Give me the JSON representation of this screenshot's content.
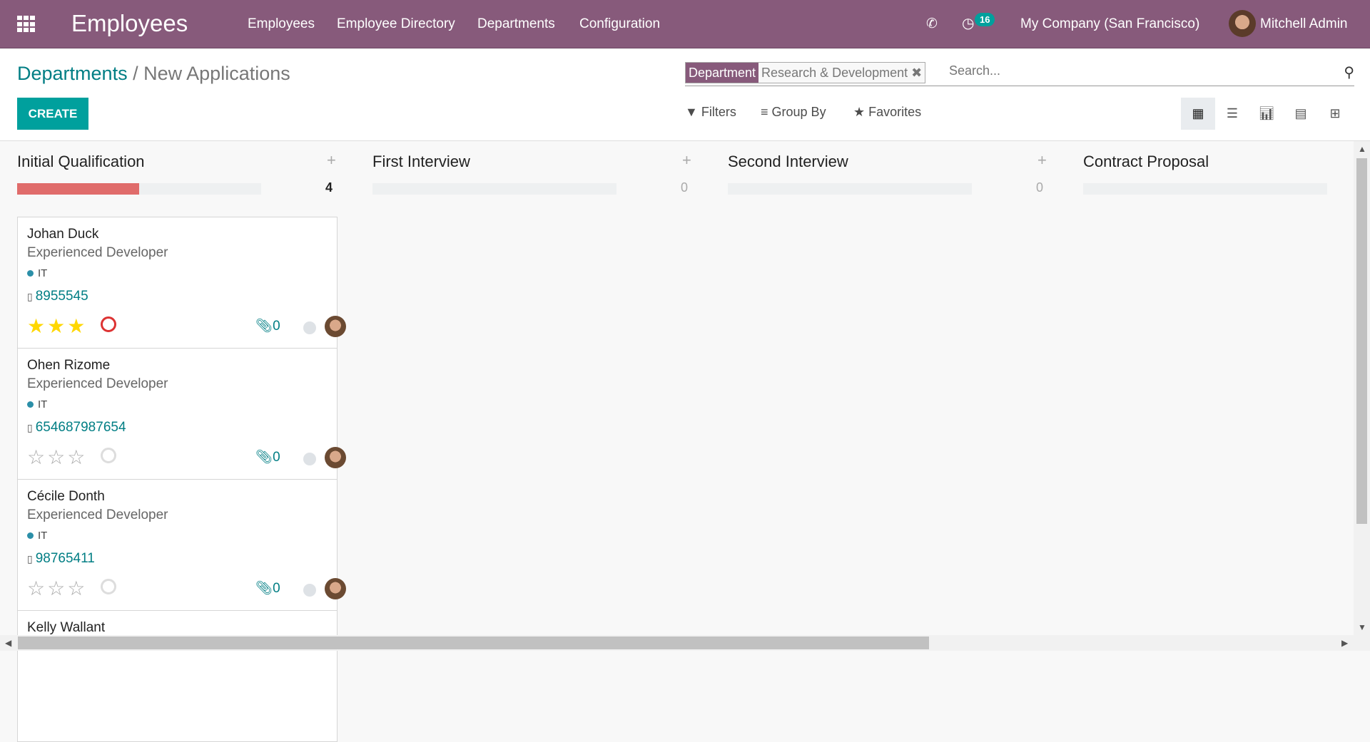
{
  "navbar": {
    "app_title": "Employees",
    "menu": [
      "Employees",
      "Employee Directory",
      "Departments",
      "Configuration"
    ],
    "activity_count": "16",
    "company": "My Company (San Francisco)",
    "user": "Mitchell Admin",
    "color": "#875A7B"
  },
  "breadcrumb": {
    "parent": "Departments",
    "separator": "/",
    "current": "New Applications"
  },
  "toolbar": {
    "create_label": "CREATE",
    "filters_label": "Filters",
    "groupby_label": "Group By",
    "favorites_label": "Favorites",
    "views": [
      "kanban",
      "list",
      "graph",
      "calendar",
      "pivot"
    ],
    "active_view": "kanban"
  },
  "search": {
    "facet_key": "Department",
    "facet_value": "Research & Development",
    "placeholder": "Search..."
  },
  "columns": [
    {
      "title": "Initial Qualification",
      "count": "4",
      "progress_red": 0.5
    },
    {
      "title": "First Interview",
      "count": "0"
    },
    {
      "title": "Second Interview",
      "count": "0"
    },
    {
      "title": "Contract Proposal"
    }
  ],
  "cards": [
    {
      "name": "Johan Duck",
      "job": "Experienced Developer",
      "tag": "IT",
      "phone": "8955545",
      "rating": 3,
      "activity": "overdue",
      "attachments": "0"
    },
    {
      "name": "Ohen Rizome",
      "job": "Experienced Developer",
      "tag": "IT",
      "phone": "654687987654",
      "rating": 0,
      "activity": "none",
      "attachments": "0"
    },
    {
      "name": "Cécile Donth",
      "job": "Experienced Developer",
      "tag": "IT",
      "phone": "98765411",
      "rating": 0,
      "activity": "none",
      "attachments": "0"
    },
    {
      "name": "Kelly Wallant"
    }
  ]
}
